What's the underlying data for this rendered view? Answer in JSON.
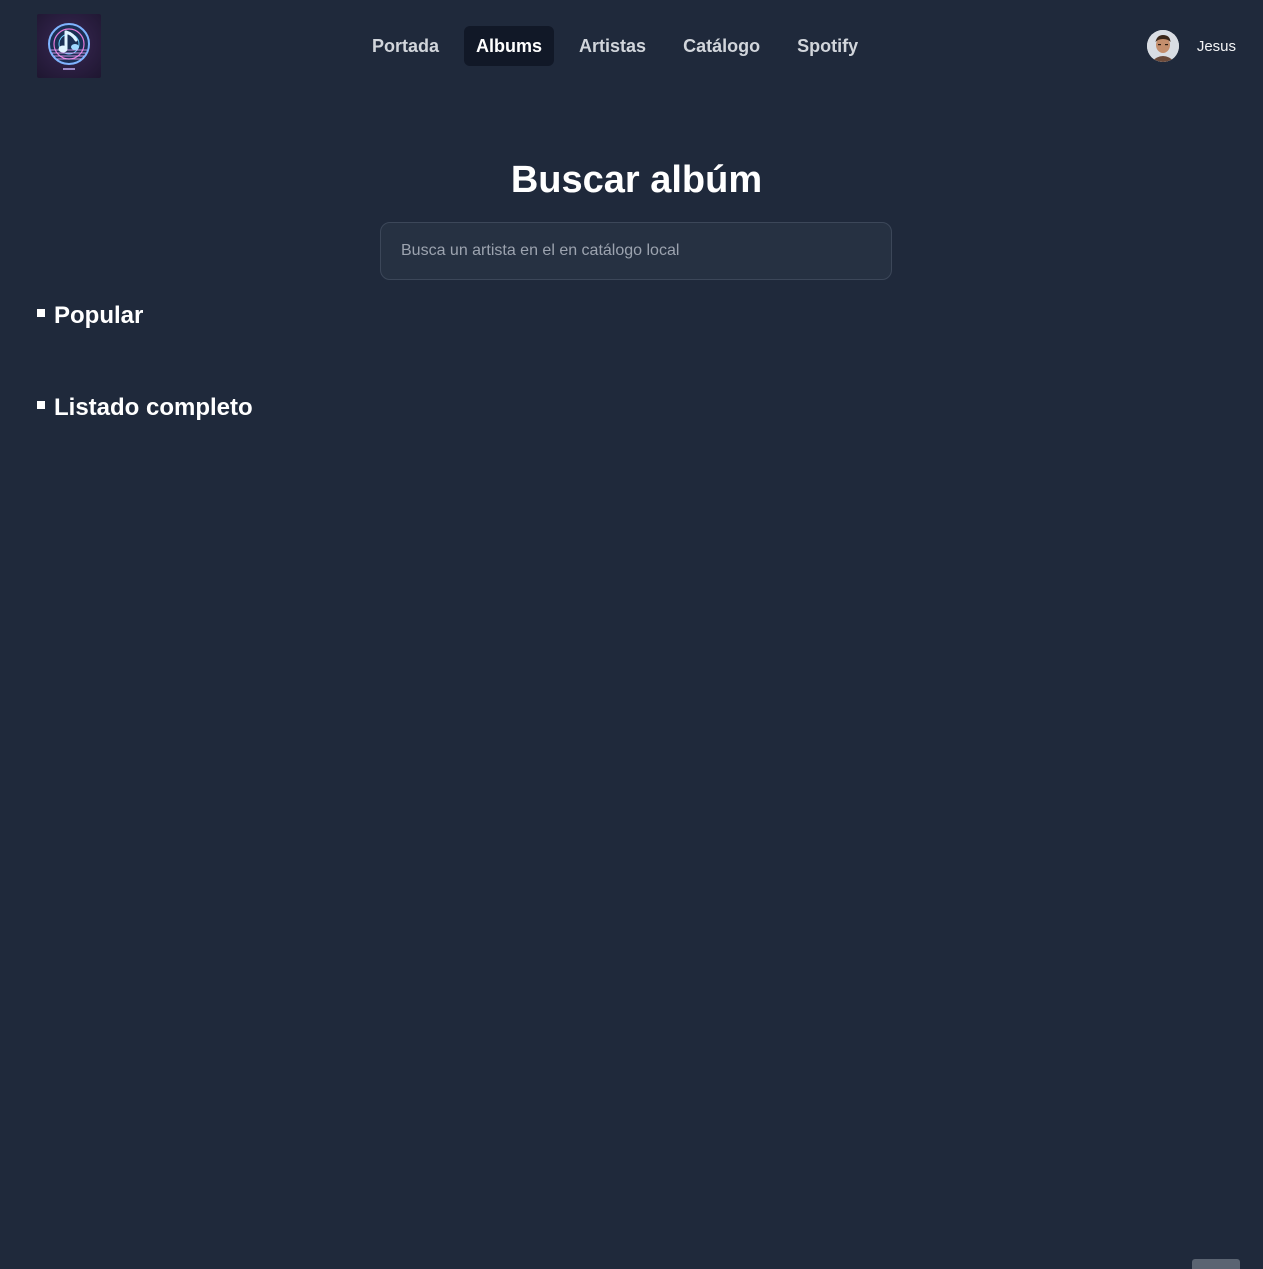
{
  "header": {
    "logo": {
      "icon": "music-note-disc-icon"
    },
    "nav": [
      {
        "label": "Portada",
        "active": false
      },
      {
        "label": "Albums",
        "active": true
      },
      {
        "label": "Artistas",
        "active": false
      },
      {
        "label": "Catálogo",
        "active": false
      },
      {
        "label": "Spotify",
        "active": false
      }
    ],
    "user": {
      "name": "Jesus",
      "avatar": "user-avatar"
    }
  },
  "main": {
    "title": "Buscar albúm",
    "search": {
      "value": "",
      "placeholder": "Busca un artista en el en catálogo local"
    },
    "sections": [
      {
        "title": "Popular"
      },
      {
        "title": "Listado completo"
      }
    ]
  },
  "colors": {
    "background": "#1f293b",
    "nav_active_bg": "#111827",
    "input_bg": "#263142",
    "input_border": "#3c4759",
    "text": "#ffffff"
  }
}
